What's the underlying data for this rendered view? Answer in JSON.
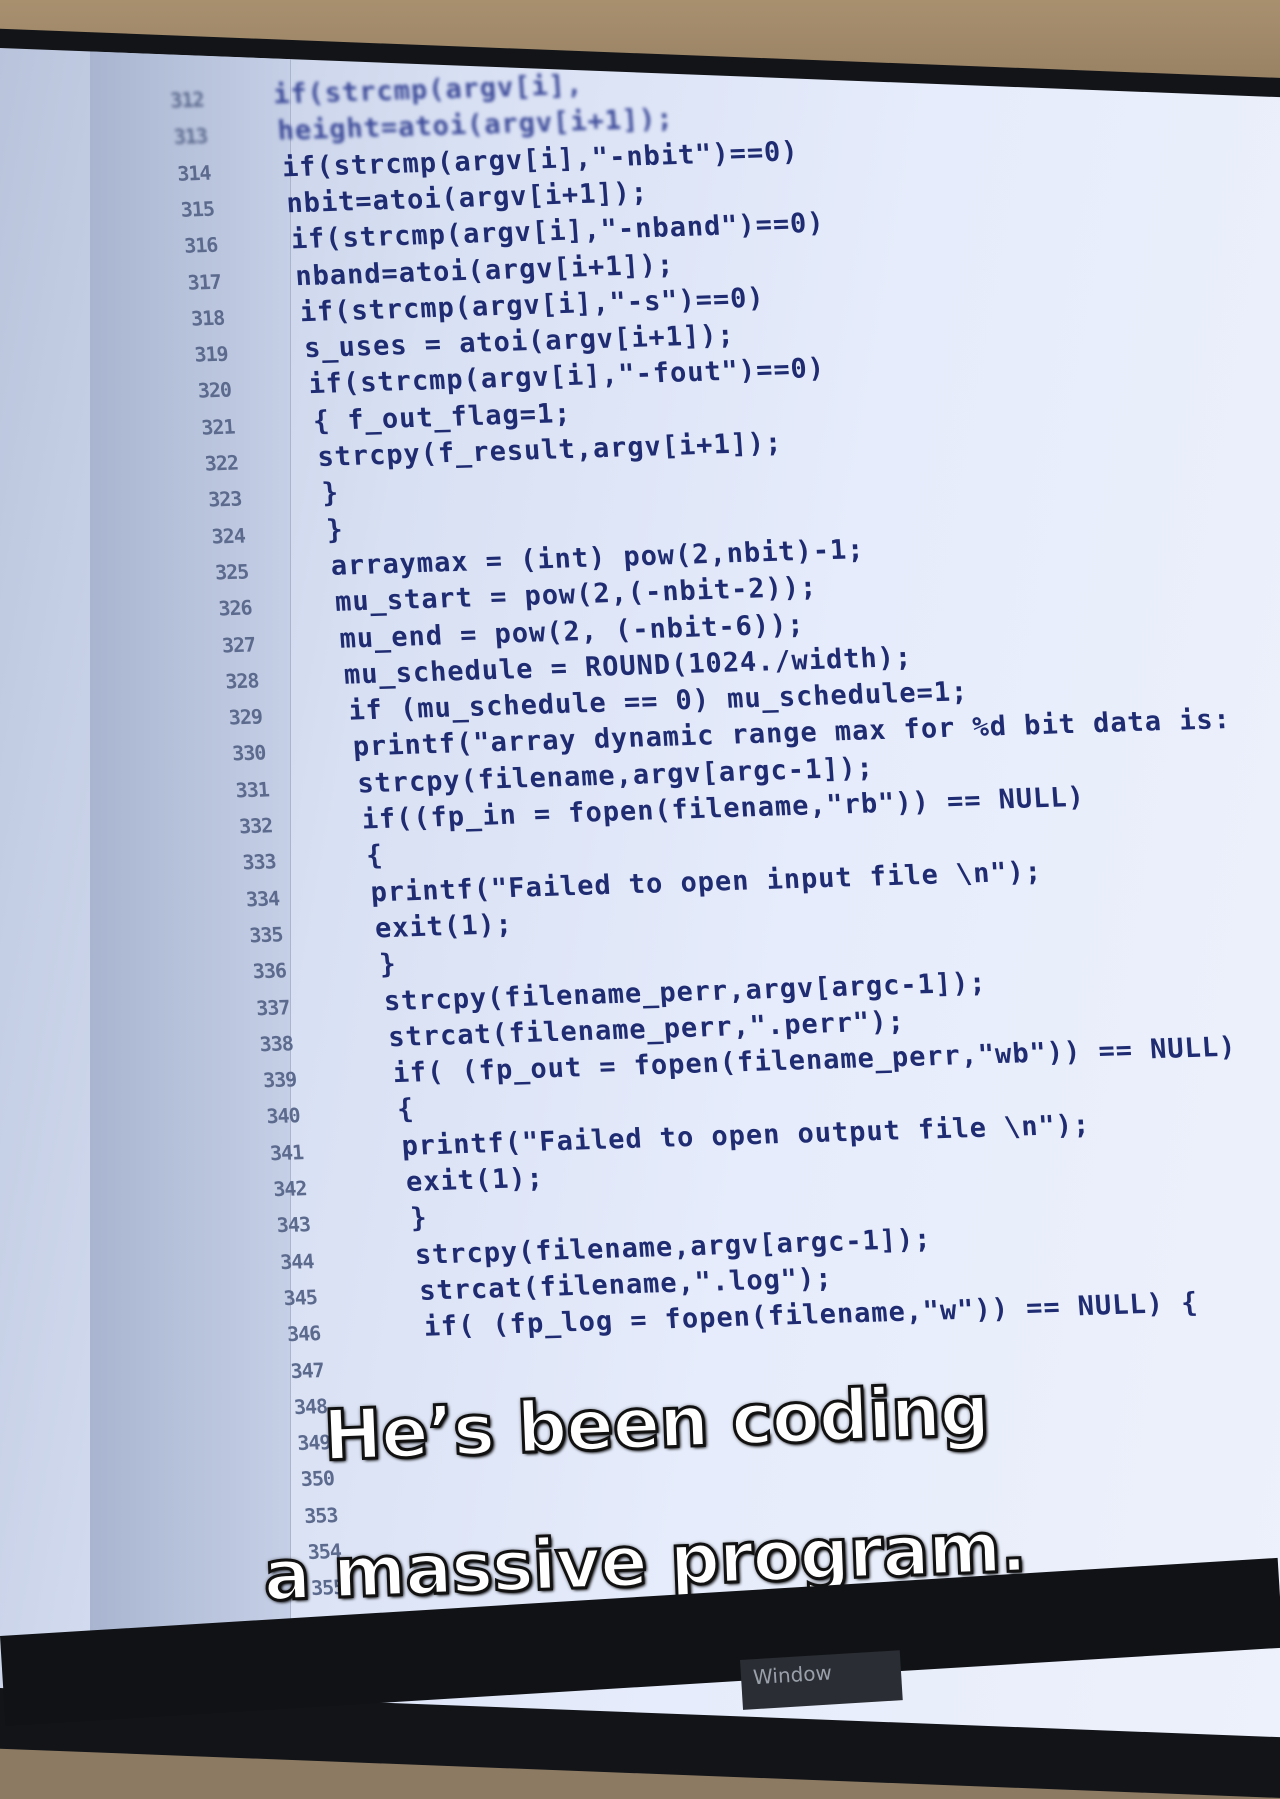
{
  "editor": {
    "lines": [
      {
        "n": "312",
        "code": "if(strcmp(argv[i],",
        "indent": 0
      },
      {
        "n": "313",
        "code": "height=atoi(argv[i+1]);",
        "indent": 0
      },
      {
        "n": "314",
        "code": "if(strcmp(argv[i],\"-nbit\")==0)",
        "indent": 0
      },
      {
        "n": "315",
        "code": "nbit=atoi(argv[i+1]);",
        "indent": 0
      },
      {
        "n": "316",
        "code": "if(strcmp(argv[i],\"-nband\")==0)",
        "indent": 0
      },
      {
        "n": "317",
        "code": "nband=atoi(argv[i+1]);",
        "indent": 0
      },
      {
        "n": "318",
        "code": "if(strcmp(argv[i],\"-s\")==0)",
        "indent": 0
      },
      {
        "n": "319",
        "code": "s_uses = atoi(argv[i+1]);",
        "indent": 0
      },
      {
        "n": "320",
        "code": "if(strcmp(argv[i],\"-fout\")==0)",
        "indent": 0
      },
      {
        "n": "321",
        "code": "{ f_out_flag=1;",
        "indent": 0
      },
      {
        "n": "322",
        "code": "strcpy(f_result,argv[i+1]);",
        "indent": 0
      },
      {
        "n": "323",
        "code": "}",
        "indent": 0
      },
      {
        "n": "324",
        "code": "}",
        "indent": 0
      },
      {
        "n": "325",
        "code": "arraymax = (int) pow(2,nbit)-1;",
        "indent": 0
      },
      {
        "n": "326",
        "code": "mu_start = pow(2,(-nbit-2));",
        "indent": 0
      },
      {
        "n": "327",
        "code": "mu_end = pow(2, (-nbit-6));",
        "indent": 0
      },
      {
        "n": "328",
        "code": "mu_schedule = ROUND(1024./width);",
        "indent": 0
      },
      {
        "n": "329",
        "code": "if (mu_schedule == 0) mu_schedule=1;",
        "indent": 0
      },
      {
        "n": "330",
        "code": "printf(\"array dynamic range max for %d bit data is:",
        "indent": 0
      },
      {
        "n": "331",
        "code": "strcpy(filename,argv[argc-1]);",
        "indent": 0
      },
      {
        "n": "332",
        "code": "if((fp_in = fopen(filename,\"rb\")) == NULL)",
        "indent": 0
      },
      {
        "n": "333",
        "code": "{",
        "indent": 0
      },
      {
        "n": "334",
        "code": "printf(\"Failed to open input file \\n\");",
        "indent": 0
      },
      {
        "n": "335",
        "code": "exit(1);",
        "indent": 0
      },
      {
        "n": "336",
        "code": "}",
        "indent": 0
      },
      {
        "n": "337",
        "code": "strcpy(filename_perr,argv[argc-1]);",
        "indent": 0
      },
      {
        "n": "338",
        "code": "strcat(filename_perr,\".perr\");",
        "indent": 0
      },
      {
        "n": "339",
        "code": "if( (fp_out = fopen(filename_perr,\"wb\")) == NULL)",
        "indent": 0
      },
      {
        "n": "340",
        "code": "{",
        "indent": 0
      },
      {
        "n": "341",
        "code": "printf(\"Failed to open output file \\n\");",
        "indent": 0
      },
      {
        "n": "342",
        "code": "exit(1);",
        "indent": 0
      },
      {
        "n": "343",
        "code": "}",
        "indent": 0
      },
      {
        "n": "344",
        "code": "strcpy(filename,argv[argc-1]);",
        "indent": 0
      },
      {
        "n": "345",
        "code": "strcat(filename,\".log\");",
        "indent": 0
      },
      {
        "n": "346",
        "code": "if( (fp_log = fopen(filename,\"w\")) == NULL) {",
        "indent": 0
      },
      {
        "n": "347",
        "code": "",
        "indent": 0
      },
      {
        "n": "348",
        "code": "",
        "indent": 0
      },
      {
        "n": "349",
        "code": "",
        "indent": 0
      },
      {
        "n": "350",
        "code": "",
        "indent": 0
      },
      {
        "n": "353",
        "code": "",
        "indent": 0
      },
      {
        "n": "354",
        "code": "",
        "indent": 0
      },
      {
        "n": "355",
        "code": "",
        "indent": 0
      }
    ]
  },
  "subtitles": {
    "line1": "He’s been coding",
    "line2": "a massive program."
  },
  "taskbar": {
    "window_label": "Window"
  }
}
